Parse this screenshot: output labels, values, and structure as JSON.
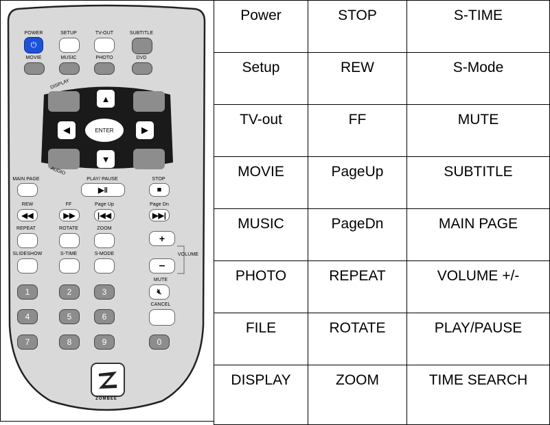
{
  "remote": {
    "top_labels": [
      "POWER",
      "SETUP",
      "TV-OUT",
      "SUBTITLE"
    ],
    "row2_labels": [
      "MOVIE",
      "MUSIC",
      "PHOTO",
      "DVD"
    ],
    "display_label": "DISPLAY",
    "audio_label": "AUDIO",
    "enter_label": "ENTER",
    "row_main": [
      "MAIN PAGE",
      "PLAY/ PAUSE",
      "STOP"
    ],
    "row_nav": [
      "REW",
      "FF",
      "Page Up",
      "Page Dn"
    ],
    "row_rep": [
      "REPEAT",
      "ROTATE",
      "ZOOM"
    ],
    "row_slide": [
      "SLIDESHOW",
      "S-TIME",
      "S-MODE"
    ],
    "volume_label": "VOLUME",
    "mute_label": "MUTE",
    "cancel_label": "CANCEL",
    "numbers": [
      "1",
      "2",
      "3",
      "4",
      "5",
      "6",
      "7",
      "8",
      "9",
      "0"
    ],
    "brand": "ZOMBEE",
    "accent_color": "#1d52d8",
    "icons": {
      "power": "power-icon",
      "up": "arrow-up-icon",
      "down": "arrow-down-icon",
      "left": "arrow-left-icon",
      "right": "arrow-right-icon",
      "play_pause": "play-pause-icon",
      "stop": "stop-icon",
      "rew": "rewind-icon",
      "ff": "fast-forward-icon",
      "page_up": "skip-back-icon",
      "page_dn": "skip-forward-icon",
      "mute": "mute-icon"
    }
  },
  "table": {
    "rows": [
      [
        "Power",
        "STOP",
        "S-TIME"
      ],
      [
        "Setup",
        "REW",
        "S-Mode"
      ],
      [
        "TV-out",
        "FF",
        "MUTE"
      ],
      [
        "MOVIE",
        "PageUp",
        "SUBTITLE"
      ],
      [
        "MUSIC",
        "PageDn",
        "MAIN PAGE"
      ],
      [
        "PHOTO",
        "REPEAT",
        "VOLUME +/-"
      ],
      [
        "FILE",
        "ROTATE",
        "PLAY/PAUSE"
      ],
      [
        "DISPLAY",
        "ZOOM",
        "TIME SEARCH"
      ]
    ]
  }
}
